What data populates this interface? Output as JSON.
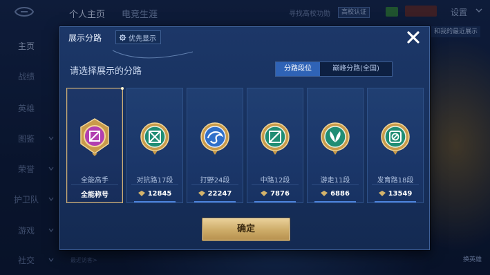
{
  "topbar": {
    "tabs": [
      "个人主页",
      "电竞生涯"
    ],
    "faded_link": "寻找高校功勋",
    "campus_badge": "高校认证",
    "settings": "设置"
  },
  "nav": {
    "items": [
      "主页",
      "战绩",
      "英雄",
      "图鉴",
      "荣誉",
      "护卫队",
      "游戏",
      "社交"
    ]
  },
  "background": {
    "recent_visitors": "最近访客>",
    "side_tab": "和我的最近展示",
    "hero_button": "换英雄"
  },
  "panel": {
    "title": "展示分路",
    "priority_label": "优先显示",
    "prompt": "请选择展示的分路",
    "segments": [
      "分路段位",
      "巅峰分路(全国)"
    ],
    "confirm": "确定"
  },
  "cards": [
    {
      "label": "全能高手",
      "footer": "全能称号",
      "emblem": "all-round-emblem",
      "selected": true
    },
    {
      "label": "对抗路17段",
      "footer": "12845",
      "emblem": "clash-lane-emblem"
    },
    {
      "label": "打野24段",
      "footer": "22247",
      "emblem": "jungle-emblem"
    },
    {
      "label": "中路12段",
      "footer": "7876",
      "emblem": "mid-lane-emblem"
    },
    {
      "label": "游走11段",
      "footer": "6886",
      "emblem": "roam-emblem"
    },
    {
      "label": "发育路18段",
      "footer": "13549",
      "emblem": "farm-lane-emblem"
    }
  ],
  "colors": {
    "accent_blue": "#2f63b6",
    "gold": "#d2b277",
    "panel_bg": "#1c3768"
  }
}
